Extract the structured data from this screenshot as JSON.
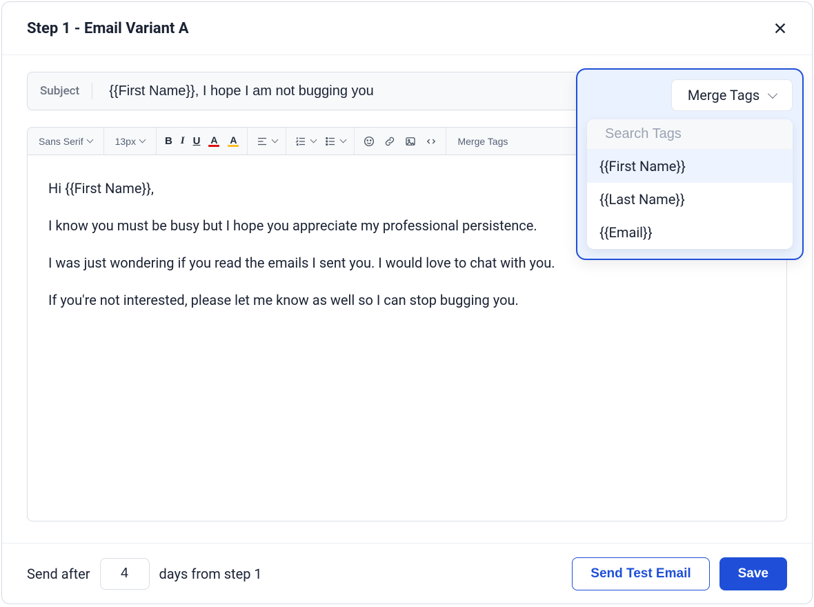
{
  "header": {
    "title": "Step 1 - Email Variant A"
  },
  "subject": {
    "label": "Subject",
    "value": "{{First Name}}, I hope I am not bugging you"
  },
  "toolbar": {
    "font_family": "Sans Serif",
    "font_size": "13px",
    "merge_tags_label": "Merge Tags"
  },
  "body": {
    "p1": "Hi {{First Name}},",
    "p2": "I know you must be busy but I hope you appreciate my professional persistence.",
    "p3": "I was just wondering if you read the emails I sent you. I would love to chat with you.",
    "p4": "If you're not interested, please let me know as well so I can stop bugging you."
  },
  "merge_panel": {
    "trigger_label": "Merge Tags",
    "search_placeholder": "Search Tags",
    "items": [
      "{{First Name}}",
      "{{Last Name}}",
      "{{Email}}"
    ]
  },
  "footer": {
    "send_prefix": "Send after",
    "days_value": "4",
    "send_suffix": "days from step 1",
    "send_test_label": "Send Test Email",
    "save_label": "Save"
  }
}
